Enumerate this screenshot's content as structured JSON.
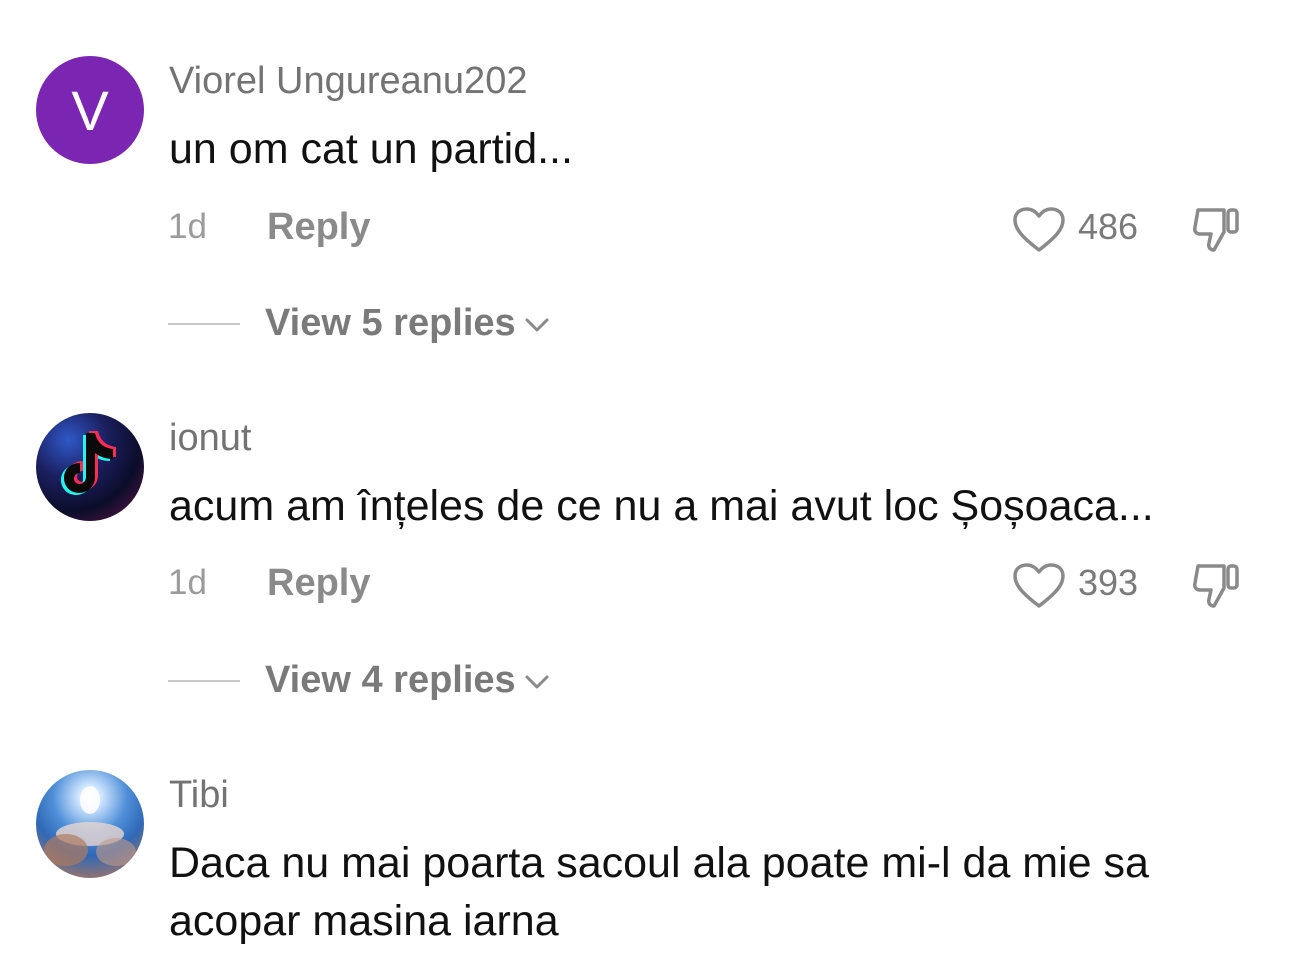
{
  "comments": [
    {
      "avatar_letter": "V",
      "avatar_color": "#7a26b3",
      "username": "Viorel Ungureanu202",
      "text": "un om cat un partid...",
      "time": "1d",
      "reply_label": "Reply",
      "like_count": "486",
      "view_replies": "View 5 replies"
    },
    {
      "avatar_icon": "tiktok-logo-icon",
      "username": "ionut",
      "text": "acum am înțeles de ce nu a mai avut loc Șoșoaca...",
      "time": "1d",
      "reply_label": "Reply",
      "like_count": "393",
      "view_replies": "View 4 replies"
    },
    {
      "avatar_icon": "profile-photo",
      "username": "Tibi",
      "text": "Daca nu mai poarta sacoul ala poate mi-l da mie sa acopar masina iarna"
    }
  ]
}
